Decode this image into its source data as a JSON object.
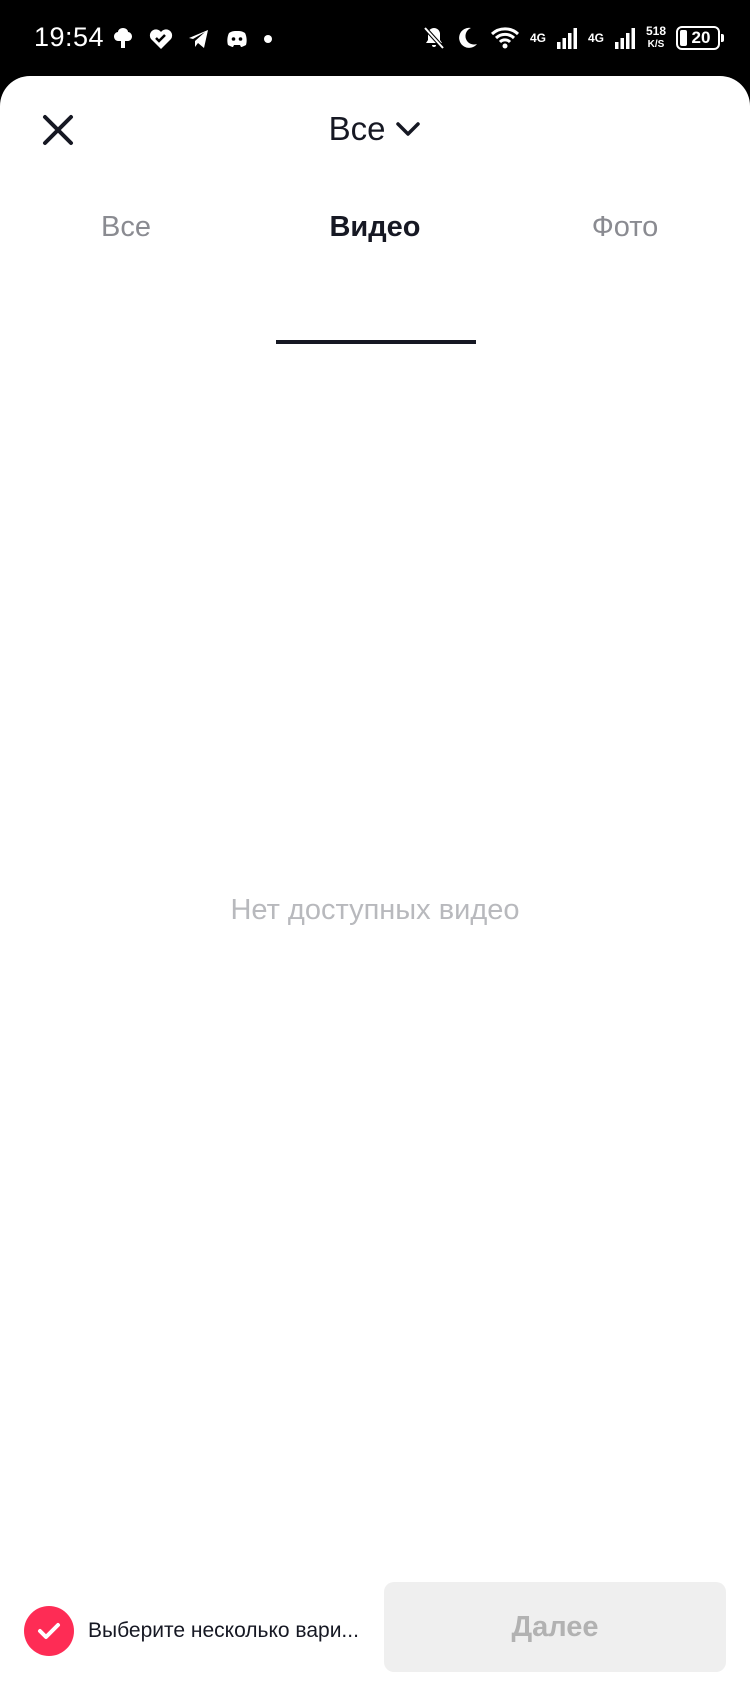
{
  "status_bar": {
    "time": "19:54",
    "left_icons": [
      "tree-icon",
      "heart-icon",
      "telegram-icon",
      "discord-icon",
      "dot-icon"
    ],
    "right_icons": [
      "bell-off-icon",
      "moon-icon",
      "wifi-icon",
      "signal-icon",
      "signal-icon"
    ],
    "network_1": "4G",
    "network_2": "4G",
    "speed_value": "518",
    "speed_unit": "K/S",
    "battery_level": "20"
  },
  "header": {
    "album_title": "Все",
    "close_icon": "close-icon",
    "dropdown_icon": "chevron-down-icon"
  },
  "tabs": [
    {
      "label": "Все",
      "active": false
    },
    {
      "label": "Видео",
      "active": true
    },
    {
      "label": "Фото",
      "active": false
    }
  ],
  "main": {
    "empty_message": "Нет доступных видео"
  },
  "footer": {
    "multi_select_label": "Выберите несколько вари...",
    "multi_select_checked": true,
    "next_button_label": "Далее",
    "next_button_enabled": false
  },
  "colors": {
    "accent": "#fe2c55",
    "text_primary": "#161823",
    "text_secondary": "#8a8b91",
    "text_placeholder": "#b8b9bd",
    "button_disabled_bg": "#efefef",
    "button_disabled_text": "#b2b2b2"
  }
}
